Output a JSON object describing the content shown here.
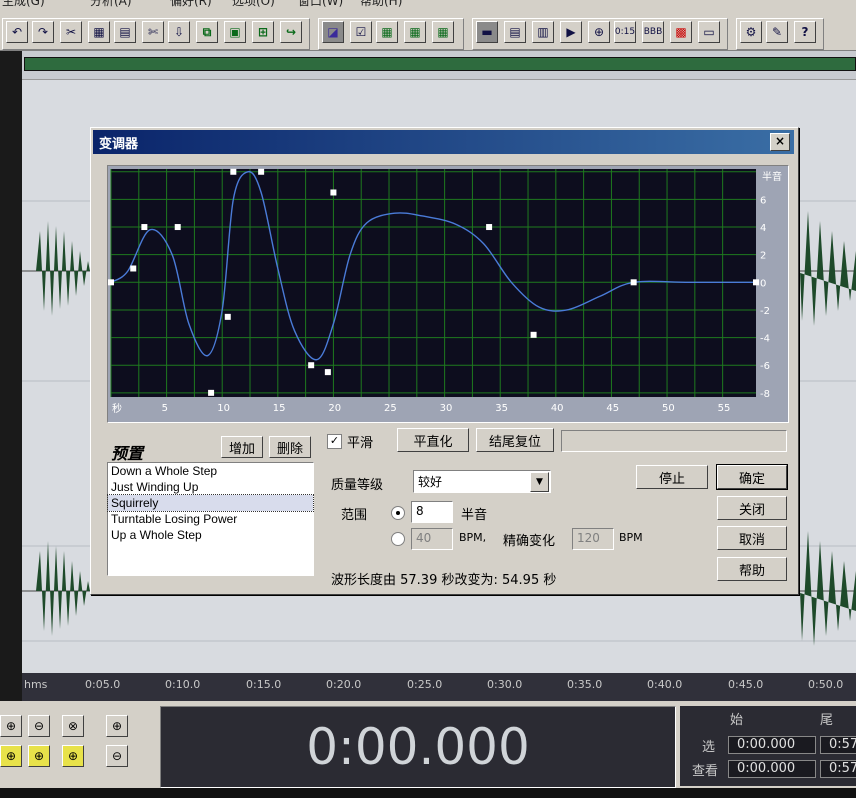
{
  "menu": {
    "items": [
      "生成(G)",
      "分析(A)",
      "偏好(R)",
      "选项(O)",
      "窗口(W)",
      "帮助(H)"
    ]
  },
  "toolbar": {
    "buttons": [
      "undo-icon",
      "redo-icon",
      "cut-icon",
      "copy-icon",
      "paste-icon",
      "scissors-icon",
      "mix-paste-icon",
      "trim-icon",
      "silence-icon",
      "new-icon",
      "arrow-icon",
      "select-icon",
      "check-icon",
      "grid-icon",
      "grid-icon",
      "grid-icon",
      "view-icon",
      "wave-icon",
      "spectral-icon",
      "play-icon",
      "zoom-icon",
      "timecode-icon",
      "bpm-icon",
      "color-icon",
      "blank-icon",
      "settings-icon",
      "script-icon",
      "help-icon"
    ],
    "timecode_label": "0:15",
    "bpm_label": "BBB",
    "help_label": "?"
  },
  "dialog": {
    "title": "变调器",
    "close_label": "×",
    "presets_title": "预置",
    "add_label": "增加",
    "delete_label": "删除",
    "presets": [
      "Down a Whole Step",
      "Just Winding Up",
      "Squirrely",
      "Turntable Losing Power",
      "Up a Whole Step"
    ],
    "selected_preset": "Squirrely",
    "smooth_label": "平滑",
    "smooth_checked": true,
    "flatten_label": "平直化",
    "reset_end_label": "结尾复位",
    "quality_label": "质量等级",
    "quality_value": "较好",
    "range_label": "范围",
    "semitone_value": "8",
    "semitone_unit": "半音",
    "bpm_value": "40",
    "bpm_unit": "BPM,",
    "precise_label": "精确变化",
    "precise_value": "120",
    "precise_unit": "BPM",
    "length_text": "波形长度由 57.39 秒改变为: 54.95 秒",
    "stop_label": "停止",
    "ok_label": "确定",
    "close_button_label": "关闭",
    "cancel_label": "取消",
    "help_label": "帮助",
    "graph": {
      "y_unit": "半音",
      "x_unit": "秒",
      "y_ticks": [
        "6",
        "4",
        "2",
        "0",
        "-2",
        "-4",
        "-6",
        "-8"
      ],
      "x_ticks": [
        "5",
        "10",
        "15",
        "20",
        "25",
        "30",
        "35",
        "40",
        "45",
        "50",
        "55"
      ],
      "colors": {
        "background": "#0d0d1e",
        "grid": "#1e7a1e",
        "curve": "#4a7bd8",
        "points": "#ffffff"
      },
      "control_points": [
        [
          0,
          0
        ],
        [
          2,
          1
        ],
        [
          3,
          4
        ],
        [
          6,
          4
        ],
        [
          9,
          -8
        ],
        [
          10.5,
          -2.5
        ],
        [
          11,
          8
        ],
        [
          13.5,
          8
        ],
        [
          18,
          -6
        ],
        [
          19.5,
          -6.5
        ],
        [
          20,
          6.5
        ],
        [
          34,
          4
        ],
        [
          38,
          -3.8
        ],
        [
          47,
          0
        ],
        [
          58,
          0
        ]
      ],
      "curve": [
        [
          0,
          0
        ],
        [
          1.5,
          0.8
        ],
        [
          3.5,
          3.8
        ],
        [
          5.5,
          2
        ],
        [
          7,
          -3
        ],
        [
          8.7,
          -5.3
        ],
        [
          10,
          -2
        ],
        [
          11,
          6
        ],
        [
          12.3,
          8
        ],
        [
          13.5,
          6.5
        ],
        [
          15,
          1
        ],
        [
          16.5,
          -3.5
        ],
        [
          18.5,
          -5.6
        ],
        [
          20,
          -3
        ],
        [
          21.5,
          2
        ],
        [
          23,
          4.3
        ],
        [
          25.5,
          5
        ],
        [
          28,
          4.8
        ],
        [
          31,
          4.2
        ],
        [
          33.5,
          2.8
        ],
        [
          36,
          0
        ],
        [
          38.5,
          -1.8
        ],
        [
          41,
          -2
        ],
        [
          44,
          -1
        ],
        [
          47,
          0
        ],
        [
          52,
          0
        ],
        [
          58,
          0
        ]
      ]
    }
  },
  "ruler": {
    "unit": "hms",
    "ticks": [
      "0:05.0",
      "0:10.0",
      "0:15.0",
      "0:20.0",
      "0:25.0",
      "0:30.0",
      "0:35.0",
      "0:40.0",
      "0:45.0",
      "0:50.0"
    ]
  },
  "transport": {
    "time": "0:00.000",
    "begin_header": "始",
    "end_header": "尾",
    "selection_label": "选",
    "view_label": "查看",
    "sel_begin": "0:00.000",
    "sel_end": "0:57",
    "view_begin": "0:00.000",
    "view_end": "0:57"
  }
}
